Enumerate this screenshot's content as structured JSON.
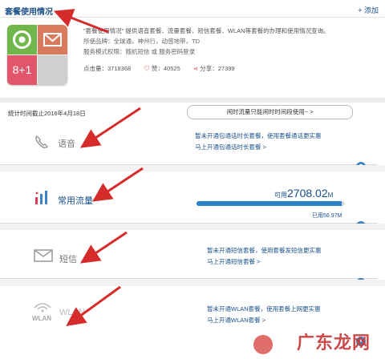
{
  "header": {
    "title": "套餐使用情况",
    "add_label": "+ 添加"
  },
  "app": {
    "tile_plus_text": "8+1",
    "description": "\"套餐使用情况\" 提供语音套餐、流量套餐、短信套餐、WLAN等套餐的办理和使用情况查询。",
    "network_label": "所使品牌：全球通，神州行，动感地带，TD",
    "permission_label": "服务模式权限：随机短信 或 服务密码登录",
    "clicks": "点击量：3718368",
    "likes": "赞：40525",
    "shares": "分享：27399"
  },
  "stats_bar": {
    "date_text": "统计时间截止2016年4月18日",
    "idle_button": "闲时流量只能闲时时间段使用~ >"
  },
  "voice": {
    "label": "语音",
    "notice_line1": "暂未开通包通话时长套餐，使用套餐通话更实惠",
    "notice_line2": "马上开通包通话时长套餐 >"
  },
  "data": {
    "label": "常用流量",
    "available_prefix": "可用",
    "available_value": "2708.02",
    "available_unit": "M",
    "used_label": "已用56.97M",
    "used_fraction": 0.98
  },
  "sms": {
    "label": "短信",
    "notice_line1": "暂未开通短信套餐，使用套餐发短信更实惠",
    "notice_line2": "马上开通短信套餐 >"
  },
  "wlan": {
    "label": "WLAN",
    "notice_line1": "暂未开通WLAN套餐，使用套餐上网更实惠",
    "notice_line2": "马上开通WLAN套餐 >"
  },
  "watermark": {
    "text": "广东龙网"
  },
  "colors": {
    "accent": "#2a7fc9",
    "annotation_arrow": "#d62b2b"
  }
}
